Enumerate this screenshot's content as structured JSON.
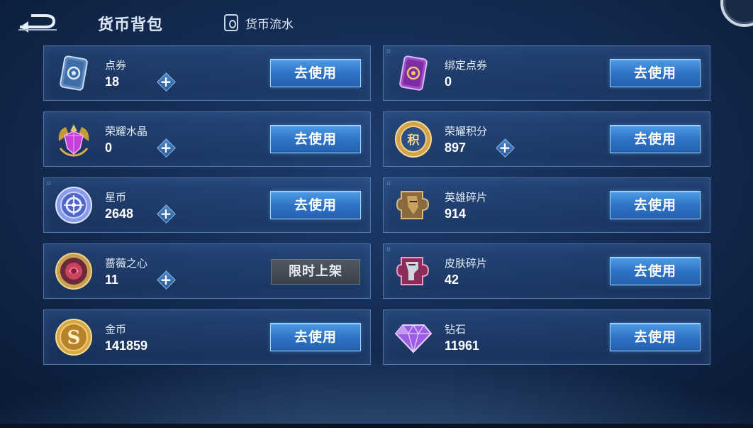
{
  "header": {
    "title": "货币背包",
    "flow_tab": "货币流水"
  },
  "currencies_left": [
    {
      "name": "点券",
      "count": "18",
      "button": "去使用",
      "icon": "ticket-icon"
    },
    {
      "name": "荣耀水晶",
      "count": "0",
      "button": "去使用",
      "icon": "crystal-icon"
    },
    {
      "name": "星币",
      "count": "2648",
      "button": "去使用",
      "icon": "star-coin-icon"
    },
    {
      "name": "蔷薇之心",
      "count": "11",
      "button": "限时上架",
      "icon": "rose-heart-icon"
    },
    {
      "name": "金币",
      "count": "141859",
      "button": "去使用",
      "icon": "gold-coin-icon"
    }
  ],
  "currencies_right": [
    {
      "name": "绑定点券",
      "count": "0",
      "button": "去使用",
      "icon": "bound-ticket-icon"
    },
    {
      "name": "荣耀积分",
      "count": "897",
      "button": "去使用",
      "icon": "glory-points-icon"
    },
    {
      "name": "英雄碎片",
      "count": "914",
      "button": "去使用",
      "icon": "hero-fragment-icon"
    },
    {
      "name": "皮肤碎片",
      "count": "42",
      "button": "去使用",
      "icon": "skin-fragment-icon"
    },
    {
      "name": "钻石",
      "count": "11961",
      "button": "去使用",
      "icon": "diamond-icon"
    }
  ],
  "colors": {
    "accent_blue": "#2e74c6",
    "background": "#132a50",
    "disabled_button": "#3a414b"
  }
}
